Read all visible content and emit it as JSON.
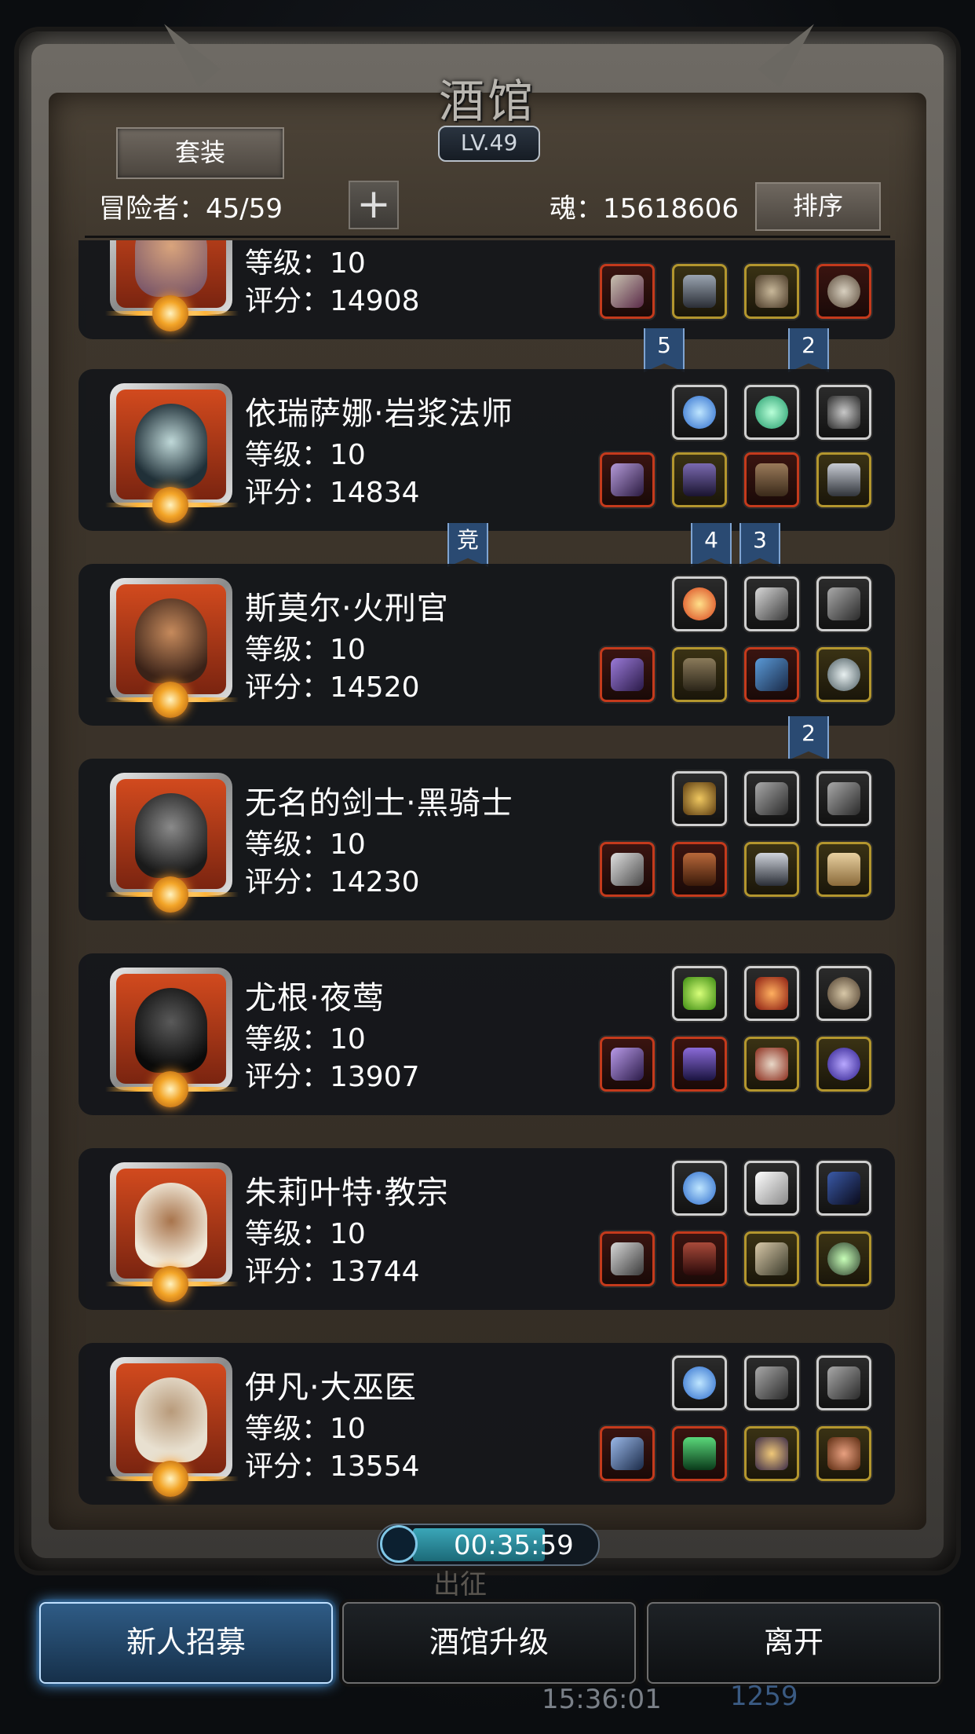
{
  "header": {
    "title": "酒馆",
    "level": "LV.49",
    "tab_label": "套装",
    "adventurers_label": "冒险者：45/59",
    "plus_label": "+",
    "soul_label": "魂：15618606",
    "sort_label": "排序"
  },
  "heroes": [
    {
      "name": "",
      "level": "等级：10",
      "score": "评分：14908"
    },
    {
      "name": "依瑞萨娜·岩浆法师",
      "level": "等级：10",
      "score": "评分：14834"
    },
    {
      "name": "斯莫尔·火刑官",
      "level": "等级：10",
      "score": "评分：14520"
    },
    {
      "name": "无名的剑士·黑骑士",
      "level": "等级：10",
      "score": "评分：14230"
    },
    {
      "name": "尤根·夜莺",
      "level": "等级：10",
      "score": "评分：13907"
    },
    {
      "name": "朱莉叶特·教宗",
      "level": "等级：10",
      "score": "评分：13744"
    },
    {
      "name": "伊凡·大巫医",
      "level": "等级：10",
      "score": "评分：13554"
    }
  ],
  "badges": [
    "5",
    "2",
    "竞",
    "4",
    "3",
    "2"
  ],
  "timer": {
    "value": "00:35:59"
  },
  "depart_label": "出征",
  "buttons": {
    "recruit": "新人招募",
    "upgrade": "酒馆升级",
    "leave": "离开"
  },
  "footer": {
    "time": "15:36:01",
    "number": "1259"
  },
  "colors": {
    "rare_red": "#c43a1c",
    "rare_gold": "#b3962e",
    "common_grey": "#cfcfcf",
    "badge_blue": "#2a4a72",
    "recruit_blue": "#2f5c86"
  }
}
